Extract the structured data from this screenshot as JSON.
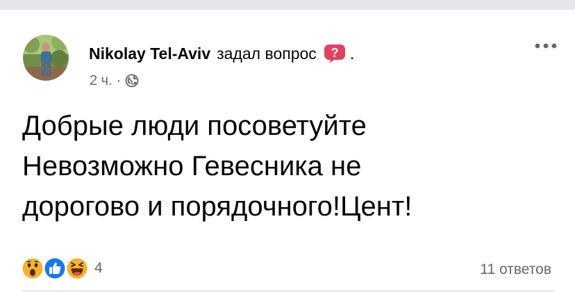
{
  "post": {
    "author": "Nikolay Tel-Aviv",
    "action": "задал вопрос",
    "trailing_punct": ".",
    "time": "2 ч.",
    "meta_separator": "·",
    "text_lines": [
      "Добрые люди посоветуйте",
      "Невозможно Гевесника не",
      "дорогово и порядочного!Цент!"
    ],
    "reactions": {
      "types": [
        "wow",
        "like",
        "haha"
      ],
      "count": "4"
    },
    "comments": "11 ответов"
  },
  "colors": {
    "text_primary": "#050505",
    "text_secondary": "#65676b",
    "like_blue": "#1877f2",
    "reaction_yellow": "#f7b125",
    "question_badge": "#e4405f",
    "page_background": "#e4e6eb",
    "card_background": "#ffffff"
  },
  "icons": {
    "avatar": "profile-photo",
    "question": "question-mark-badge-icon",
    "privacy": "globe-icon",
    "more": "more-horizontal-icon",
    "reactions": [
      "wow-reaction-icon",
      "like-reaction-icon",
      "haha-reaction-icon"
    ]
  }
}
